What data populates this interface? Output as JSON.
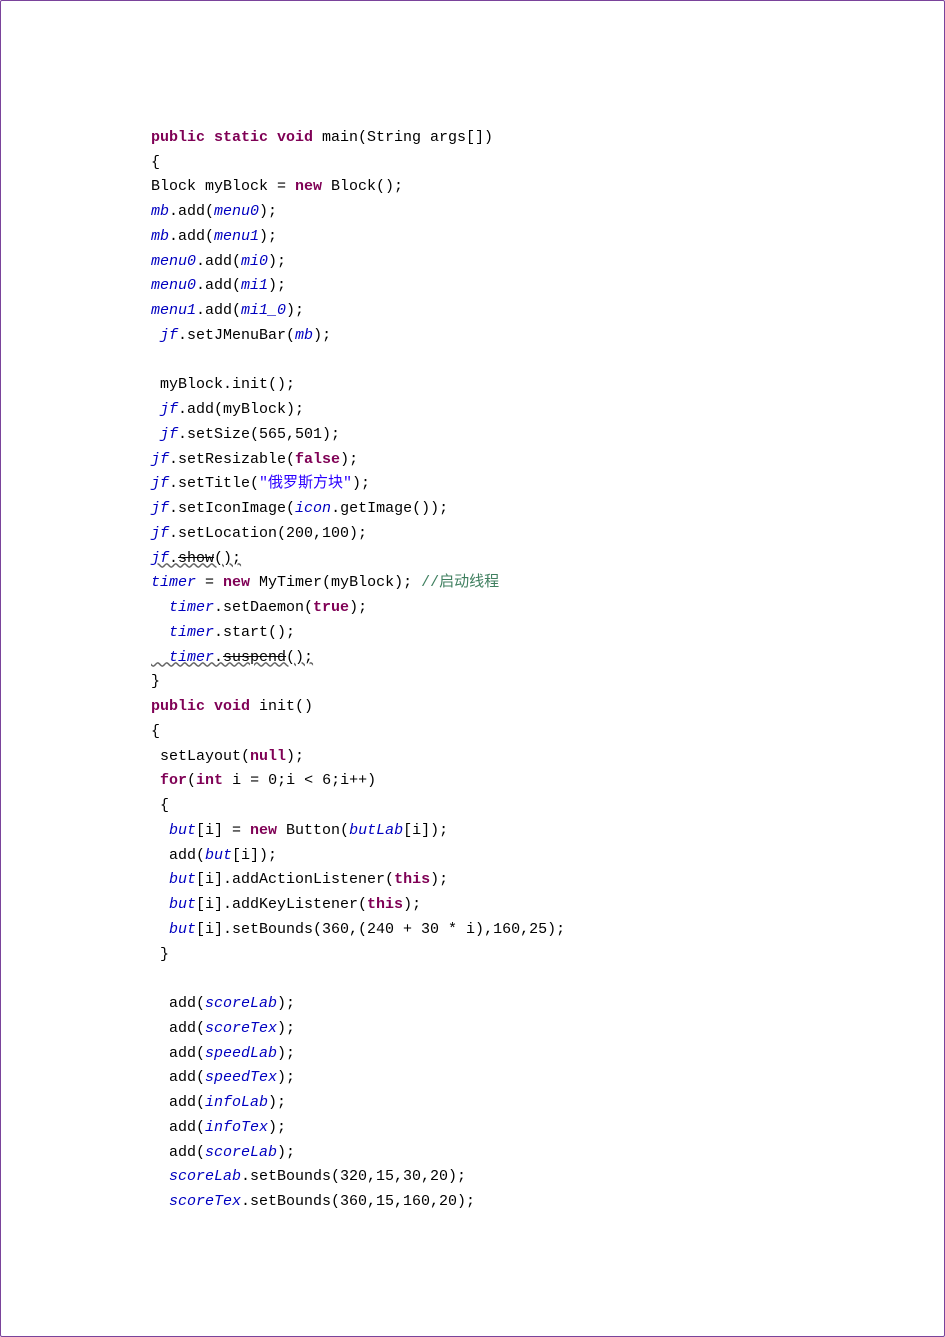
{
  "t": {
    "l0_kw1": "public static void",
    "l0_id": " main(String args[])",
    "l1": "{",
    "l2a": "Block myBlock = ",
    "l2kw": "new",
    "l2b": " Block();",
    "l3a": "mb",
    "l3b": ".add(",
    "l3c": "menu0",
    "l3d": ");",
    "l4a": "mb",
    "l4b": ".add(",
    "l4c": "menu1",
    "l4d": ");",
    "l5a": "menu0",
    "l5b": ".add(",
    "l5c": "mi0",
    "l5d": ");",
    "l6a": "menu0",
    "l6b": ".add(",
    "l6c": "mi1",
    "l6d": ");",
    "l7a": "menu1",
    "l7b": ".add(",
    "l7c": "mi1_0",
    "l7d": ");",
    "l8a": " jf",
    "l8b": ".setJMenuBar(",
    "l8c": "mb",
    "l8d": ");",
    "l9": "",
    "l10": " myBlock.init();",
    "l11a": " jf",
    "l11b": ".add(myBlock);",
    "l12a": " jf",
    "l12b": ".setSize(565,501);",
    "l13a": "jf",
    "l13b": ".setResizable(",
    "l13kw": "false",
    "l13c": ");",
    "l14a": "jf",
    "l14b": ".setTitle(",
    "l14s": "\"俄罗斯方块\"",
    "l14c": ");",
    "l15a": "jf",
    "l15b": ".setIconImage(",
    "l15c": "icon",
    "l15d": ".getImage());",
    "l16a": "jf",
    "l16b": ".setLocation(200,100);",
    "l17a": "jf",
    "l17b": ".",
    "l17c": "show",
    "l17d": "();",
    "l18a": "timer",
    "l18b": " = ",
    "l18kw": "new",
    "l18c": " MyTimer(myBlock); ",
    "l18cmt": "//启动线程",
    "l19a": "  timer",
    "l19b": ".setDaemon(",
    "l19kw": "true",
    "l19c": ");",
    "l20a": "  timer",
    "l20b": ".start();",
    "l21a": "  timer",
    "l21b": ".",
    "l21c": "suspend",
    "l21d": "();",
    "l22": "}",
    "l23kw": "public void",
    "l23b": " init()",
    "l24": "{",
    "l25a": " setLayout(",
    "l25kw": "null",
    "l25b": ");",
    "l26a": " ",
    "l26kw1": "for",
    "l26b": "(",
    "l26kw2": "int",
    "l26c": " i = 0;i < 6;i++)",
    "l27": " {",
    "l28a": "  but",
    "l28b": "[i] = ",
    "l28kw": "new",
    "l28c": " Button(",
    "l28d": "butLab",
    "l28e": "[i]);",
    "l29a": "  add(",
    "l29b": "but",
    "l29c": "[i]);",
    "l30a": "  but",
    "l30b": "[i].addActionListener(",
    "l30kw": "this",
    "l30c": ");",
    "l31a": "  but",
    "l31b": "[i].addKeyListener(",
    "l31kw": "this",
    "l31c": ");",
    "l32a": "  but",
    "l32b": "[i].setBounds(360,(240 + 30 * i),160,25);",
    "l33": " }",
    "l34": "",
    "l35a": "  add(",
    "l35b": "scoreLab",
    "l35c": ");",
    "l36a": "  add(",
    "l36b": "scoreTex",
    "l36c": ");",
    "l37a": "  add(",
    "l37b": "speedLab",
    "l37c": ");",
    "l38a": "  add(",
    "l38b": "speedTex",
    "l38c": ");",
    "l39a": "  add(",
    "l39b": "infoLab",
    "l39c": ");",
    "l40a": "  add(",
    "l40b": "infoTex",
    "l40c": ");",
    "l41a": "  add(",
    "l41b": "scoreLab",
    "l41c": ");",
    "l42a": "  scoreLab",
    "l42b": ".setBounds(320,15,30,20);",
    "l43a": "  scoreTex",
    "l43b": ".setBounds(360,15,160,20);"
  }
}
